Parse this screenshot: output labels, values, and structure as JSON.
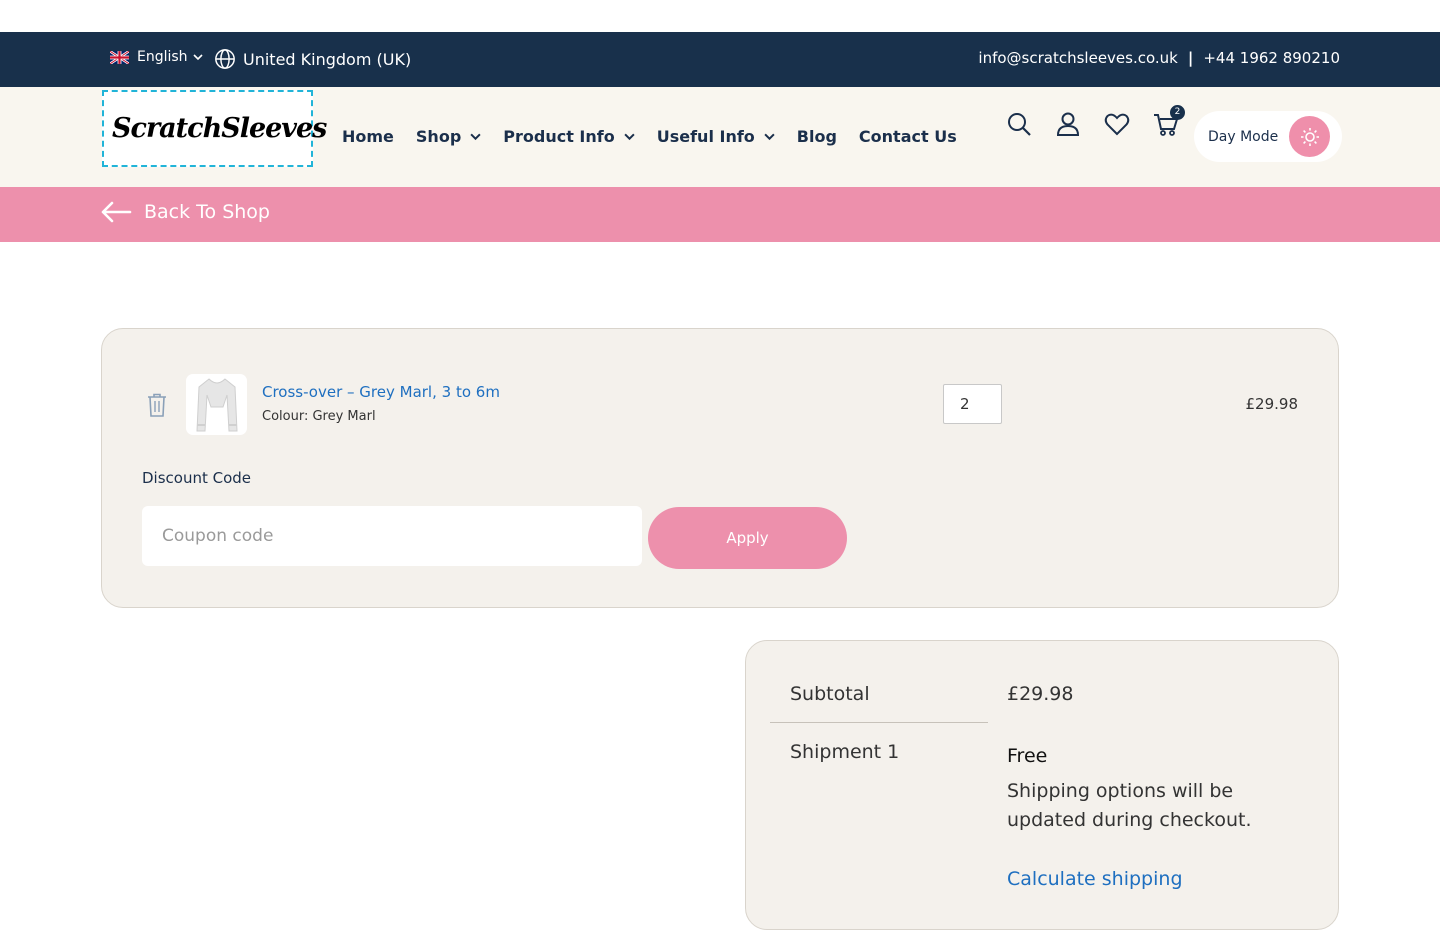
{
  "topbar": {
    "language": "English",
    "region": "United Kingdom (UK)",
    "email": "info@scratchsleeves.co.uk",
    "separator": "|",
    "phone": "+44 1962 890210"
  },
  "header": {
    "logo_text": "ScratchSleeves",
    "nav": [
      {
        "label": "Home"
      },
      {
        "label": "Shop"
      },
      {
        "label": "Product Info"
      },
      {
        "label": "Useful Info"
      },
      {
        "label": "Blog"
      },
      {
        "label": "Contact Us"
      }
    ],
    "cart_count": "2",
    "day_mode_label": "Day Mode",
    "icons": [
      "search-icon",
      "user-icon",
      "heart-icon",
      "cart-icon",
      "sun-icon"
    ]
  },
  "back_bar": {
    "label": "Back To Shop"
  },
  "cart": {
    "item": {
      "name": "Cross-over – Grey Marl, 3 to 6m",
      "meta": "Colour: Grey Marl",
      "quantity": "2",
      "price": "£29.98"
    },
    "discount_label": "Discount Code",
    "coupon_placeholder": "Coupon code",
    "apply_label": "Apply"
  },
  "totals": {
    "subtotal_label": "Subtotal",
    "subtotal_value": "£29.98",
    "shipment_label": "Shipment 1",
    "shipment_value": "Free",
    "shipping_note": "Shipping options will be updated during checkout.",
    "calculate_label": "Calculate shipping"
  },
  "colors": {
    "navy": "#18304b",
    "pink": "#ed90ac",
    "cream": "#f9f6ef",
    "card": "#f4f1ec",
    "link": "#1e6fc0"
  }
}
